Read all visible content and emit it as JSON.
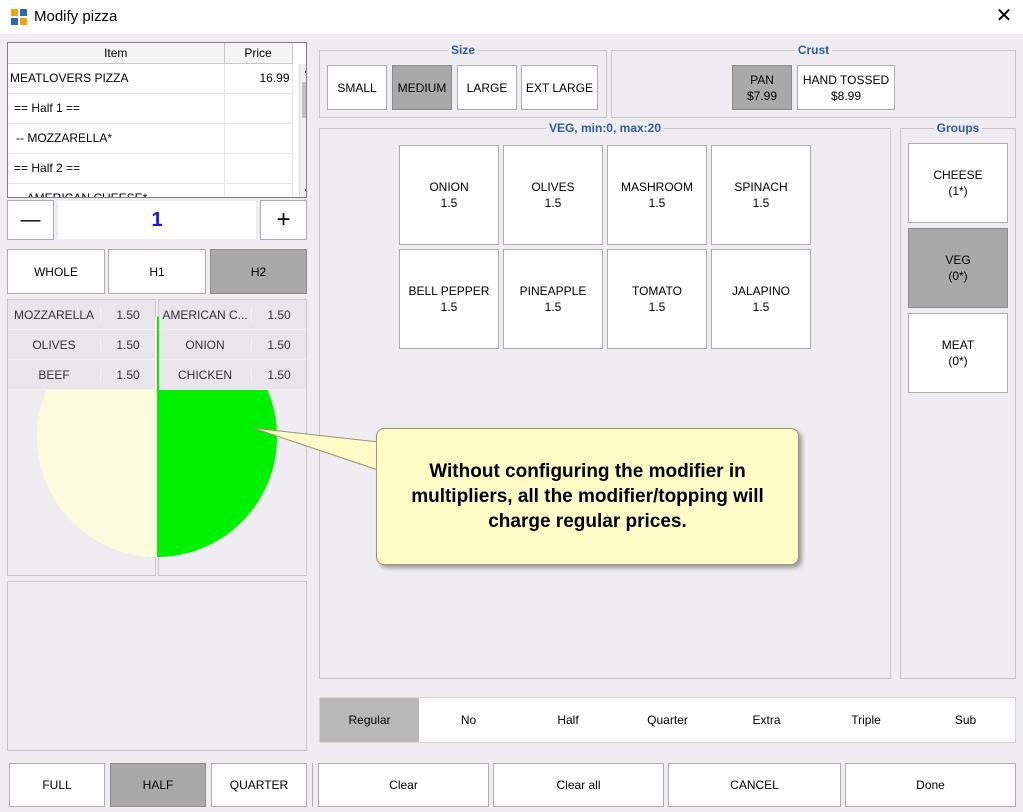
{
  "window": {
    "title": "Modify pizza"
  },
  "order": {
    "headers": {
      "item": "Item",
      "price": "Price"
    },
    "rows": [
      {
        "item": "MEATLOVERS PIZZA",
        "price": "16.99"
      },
      {
        "item": "== Half 1 ==",
        "price": ""
      },
      {
        "item": " -- MOZZARELLA*",
        "price": ""
      },
      {
        "item": "== Half 2 ==",
        "price": ""
      },
      {
        "item": " -- AMERICAN CHEESE*",
        "price": ""
      }
    ]
  },
  "quantity": {
    "minus": "—",
    "value": "1",
    "plus": "+"
  },
  "portion_tabs": [
    "WHOLE",
    "H1",
    "H2"
  ],
  "toppings": {
    "left": [
      {
        "name": "MOZZARELLA",
        "price": "1.50"
      },
      {
        "name": "OLIVES",
        "price": "1.50"
      },
      {
        "name": "BEEF",
        "price": "1.50"
      }
    ],
    "right": [
      {
        "name": "AMERICAN C...",
        "price": "1.50"
      },
      {
        "name": "ONION",
        "price": "1.50"
      },
      {
        "name": "CHICKEN",
        "price": "1.50"
      }
    ]
  },
  "size": {
    "label": "Size",
    "options": [
      "SMALL",
      "MEDIUM",
      "LARGE",
      "EXT LARGE"
    ],
    "selected": "MEDIUM"
  },
  "crust": {
    "label": "Crust",
    "options": [
      {
        "name": "PAN",
        "price": "$7.99"
      },
      {
        "name": "HAND TOSSED",
        "price": "$8.99"
      }
    ],
    "selected": "PAN"
  },
  "modifiers": {
    "label": "VEG, min:0, max:20",
    "items": [
      {
        "name": "ONION",
        "price": "1.5"
      },
      {
        "name": "OLIVES",
        "price": "1.5"
      },
      {
        "name": "MASHROOM",
        "price": "1.5"
      },
      {
        "name": "SPINACH",
        "price": "1.5"
      },
      {
        "name": "BELL PEPPER",
        "price": "1.5"
      },
      {
        "name": "PINEAPPLE",
        "price": "1.5"
      },
      {
        "name": "TOMATO",
        "price": "1.5"
      },
      {
        "name": "JALAPINO",
        "price": "1.5"
      }
    ]
  },
  "groups": {
    "label": "Groups",
    "items": [
      {
        "name": "CHEESE",
        "count": "(1*)"
      },
      {
        "name": "VEG",
        "count": "(0*)"
      },
      {
        "name": "MEAT",
        "count": "(0*)"
      }
    ],
    "selected": "VEG"
  },
  "tooltip": {
    "text": "Without configuring the modifier in multipliers, all the modifier/topping will charge regular prices."
  },
  "multipliers": [
    "Regular",
    "No",
    "Half",
    "Quarter",
    "Extra",
    "Triple",
    "Sub"
  ],
  "multiplier_selected": "Regular",
  "pizza_split": [
    "FULL",
    "HALF",
    "QUARTER"
  ],
  "pizza_split_selected": "HALF",
  "footer": {
    "clear": "Clear",
    "clear_all": "Clear all",
    "cancel": "CANCEL",
    "done": "Done"
  },
  "colors": {
    "half1": "#fdfbdd",
    "half2": "#00f200",
    "accent": "#2d5d9c",
    "qty": "#1a1adb"
  }
}
